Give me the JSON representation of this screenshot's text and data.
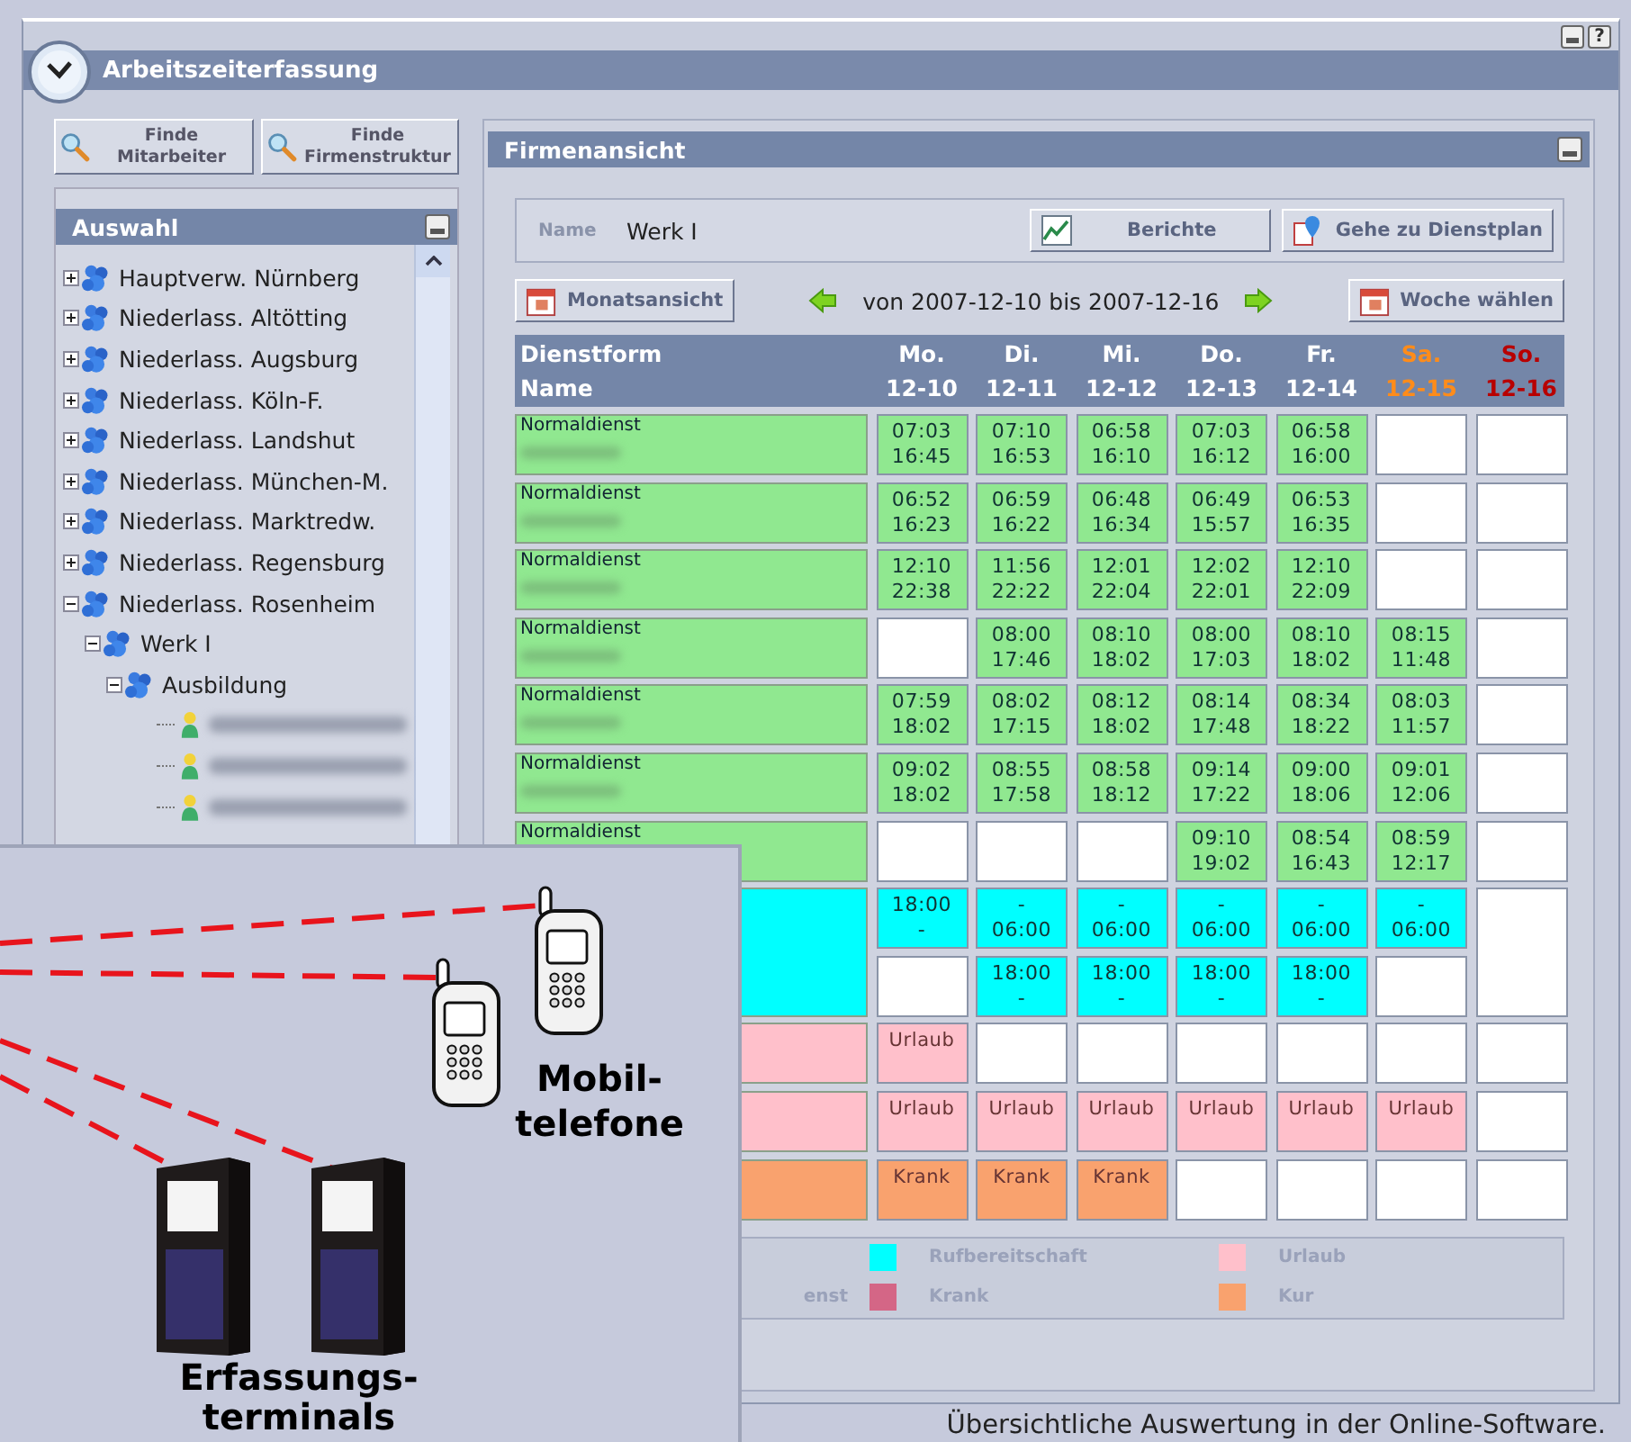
{
  "window": {
    "title": "Arbeitszeiterfassung",
    "help_glyph": "?"
  },
  "search_buttons": [
    {
      "lines": [
        "Finde",
        "Mitarbeiter"
      ]
    },
    {
      "lines": [
        "Finde",
        "Firmenstruktur"
      ]
    }
  ],
  "selection_panel": {
    "title": "Auswahl",
    "tree": [
      {
        "kind": "group",
        "label": "Hauptverw. Nürnberg",
        "expanded": false
      },
      {
        "kind": "group",
        "label": "Niederlass. Altötting",
        "expanded": false
      },
      {
        "kind": "group",
        "label": "Niederlass. Augsburg",
        "expanded": false
      },
      {
        "kind": "group",
        "label": "Niederlass. Köln-F.",
        "expanded": false
      },
      {
        "kind": "group",
        "label": "Niederlass. Landshut",
        "expanded": false
      },
      {
        "kind": "group",
        "label": "Niederlass. München-M.",
        "expanded": false
      },
      {
        "kind": "group",
        "label": "Niederlass. Marktredw.",
        "expanded": false
      },
      {
        "kind": "group",
        "label": "Niederlass. Regensburg",
        "expanded": false
      },
      {
        "kind": "group",
        "label": "Niederlass. Rosenheim",
        "expanded": true,
        "children": [
          {
            "kind": "group",
            "label": "Werk I",
            "expanded": true,
            "children": [
              {
                "kind": "group",
                "label": "Ausbildung",
                "expanded": true,
                "children": [
                  {
                    "kind": "person"
                  },
                  {
                    "kind": "person"
                  },
                  {
                    "kind": "person"
                  }
                ]
              }
            ]
          }
        ]
      }
    ]
  },
  "company_view": {
    "title": "Firmenansicht",
    "name_label": "Name",
    "name_value": "Werk I",
    "buttons": [
      "Berichte",
      "Gehe zu Dienstplan"
    ],
    "month_button": "Monatsansicht",
    "range": "von 2007-12-10 bis 2007-12-16",
    "week_button": "Woche wählen",
    "table": {
      "header": [
        "Dienstform",
        "Name"
      ],
      "days": [
        {
          "day": "Mo.",
          "date": "12-10",
          "kind": "weekday"
        },
        {
          "day": "Di.",
          "date": "12-11",
          "kind": "weekday"
        },
        {
          "day": "Mi.",
          "date": "12-12",
          "kind": "weekday"
        },
        {
          "day": "Do.",
          "date": "12-13",
          "kind": "weekday"
        },
        {
          "day": "Fr.",
          "date": "12-14",
          "kind": "weekday"
        },
        {
          "day": "Sa.",
          "date": "12-15",
          "kind": "saturday"
        },
        {
          "day": "So.",
          "date": "12-16",
          "kind": "sunday"
        }
      ],
      "rows": [
        {
          "name_cell": {
            "kind": "work",
            "label": "Normaldienst",
            "name_hidden": true
          },
          "cells": [
            {
              "kind": "work",
              "lines": [
                "07:03",
                "16:45"
              ]
            },
            {
              "kind": "work",
              "lines": [
                "07:10",
                "16:53"
              ]
            },
            {
              "kind": "work",
              "lines": [
                "06:58",
                "16:10"
              ]
            },
            {
              "kind": "work",
              "lines": [
                "07:03",
                "16:12"
              ]
            },
            {
              "kind": "work",
              "lines": [
                "06:58",
                "16:00"
              ]
            },
            {
              "kind": "empty"
            },
            {
              "kind": "empty"
            }
          ]
        },
        {
          "name_cell": {
            "kind": "work",
            "label": "Normaldienst",
            "name_hidden": true
          },
          "cells": [
            {
              "kind": "work",
              "lines": [
                "06:52",
                "16:23"
              ]
            },
            {
              "kind": "work",
              "lines": [
                "06:59",
                "16:22"
              ]
            },
            {
              "kind": "work",
              "lines": [
                "06:48",
                "16:34"
              ]
            },
            {
              "kind": "work",
              "lines": [
                "06:49",
                "15:57"
              ]
            },
            {
              "kind": "work",
              "lines": [
                "06:53",
                "16:35"
              ]
            },
            {
              "kind": "empty"
            },
            {
              "kind": "empty"
            }
          ]
        },
        {
          "name_cell": {
            "kind": "work",
            "label": "Normaldienst",
            "name_hidden": true
          },
          "cells": [
            {
              "kind": "work",
              "lines": [
                "12:10",
                "22:38"
              ]
            },
            {
              "kind": "work",
              "lines": [
                "11:56",
                "22:22"
              ]
            },
            {
              "kind": "work",
              "lines": [
                "12:01",
                "22:04"
              ]
            },
            {
              "kind": "work",
              "lines": [
                "12:02",
                "22:01"
              ]
            },
            {
              "kind": "work",
              "lines": [
                "12:10",
                "22:09"
              ]
            },
            {
              "kind": "empty"
            },
            {
              "kind": "empty"
            }
          ]
        },
        {
          "name_cell": {
            "kind": "work",
            "label": "Normaldienst",
            "name_hidden": true
          },
          "cells": [
            {
              "kind": "empty"
            },
            {
              "kind": "work",
              "lines": [
                "08:00",
                "17:46"
              ]
            },
            {
              "kind": "work",
              "lines": [
                "08:10",
                "18:02"
              ]
            },
            {
              "kind": "work",
              "lines": [
                "08:00",
                "17:03"
              ]
            },
            {
              "kind": "work",
              "lines": [
                "08:10",
                "18:02"
              ]
            },
            {
              "kind": "work",
              "lines": [
                "08:15",
                "11:48"
              ]
            },
            {
              "kind": "empty"
            }
          ]
        },
        {
          "name_cell": {
            "kind": "work",
            "label": "Normaldienst",
            "name_hidden": true
          },
          "cells": [
            {
              "kind": "work",
              "lines": [
                "07:59",
                "18:02"
              ]
            },
            {
              "kind": "work",
              "lines": [
                "08:02",
                "17:15"
              ]
            },
            {
              "kind": "work",
              "lines": [
                "08:12",
                "18:02"
              ]
            },
            {
              "kind": "work",
              "lines": [
                "08:14",
                "17:48"
              ]
            },
            {
              "kind": "work",
              "lines": [
                "08:34",
                "18:22"
              ]
            },
            {
              "kind": "work",
              "lines": [
                "08:03",
                "11:57"
              ]
            },
            {
              "kind": "empty"
            }
          ]
        },
        {
          "name_cell": {
            "kind": "work",
            "label": "Normaldienst",
            "name_hidden": true
          },
          "cells": [
            {
              "kind": "work",
              "lines": [
                "09:02",
                "18:02"
              ]
            },
            {
              "kind": "work",
              "lines": [
                "08:55",
                "17:58"
              ]
            },
            {
              "kind": "work",
              "lines": [
                "08:58",
                "18:12"
              ]
            },
            {
              "kind": "work",
              "lines": [
                "09:14",
                "17:22"
              ]
            },
            {
              "kind": "work",
              "lines": [
                "09:00",
                "18:06"
              ]
            },
            {
              "kind": "work",
              "lines": [
                "09:01",
                "12:06"
              ]
            },
            {
              "kind": "empty"
            }
          ]
        },
        {
          "name_cell": {
            "kind": "work",
            "label": "Normaldienst",
            "name_hidden": false
          },
          "cells": [
            {
              "kind": "empty"
            },
            {
              "kind": "empty"
            },
            {
              "kind": "empty"
            },
            {
              "kind": "work",
              "lines": [
                "09:10",
                "19:02"
              ]
            },
            {
              "kind": "work",
              "lines": [
                "08:54",
                "16:43"
              ]
            },
            {
              "kind": "work",
              "lines": [
                "08:59",
                "12:17"
              ]
            },
            {
              "kind": "empty"
            }
          ]
        },
        {
          "name_cell": {
            "kind": "standby",
            "tall": true
          },
          "cells": [
            {
              "kind": "standby",
              "lines": [
                "18:00",
                "-"
              ]
            },
            {
              "kind": "standby",
              "lines": [
                "-",
                "06:00"
              ]
            },
            {
              "kind": "standby",
              "lines": [
                "-",
                "06:00"
              ]
            },
            {
              "kind": "standby",
              "lines": [
                "-",
                "06:00"
              ]
            },
            {
              "kind": "standby",
              "lines": [
                "-",
                "06:00"
              ]
            },
            {
              "kind": "standby",
              "lines": [
                "-",
                "06:00"
              ]
            },
            {
              "kind": "empty",
              "tall": true
            }
          ]
        },
        {
          "cells": [
            {
              "kind": "empty"
            },
            {
              "kind": "standby",
              "lines": [
                "18:00",
                "-"
              ]
            },
            {
              "kind": "standby",
              "lines": [
                "18:00",
                "-"
              ]
            },
            {
              "kind": "standby",
              "lines": [
                "18:00",
                "-"
              ]
            },
            {
              "kind": "standby",
              "lines": [
                "18:00",
                "-"
              ]
            },
            {
              "kind": "empty"
            }
          ]
        },
        {
          "name_cell": {
            "kind": "vacation"
          },
          "cells": [
            {
              "kind": "vacation",
              "lines": [
                "Urlaub"
              ]
            },
            {
              "kind": "empty"
            },
            {
              "kind": "empty"
            },
            {
              "kind": "empty"
            },
            {
              "kind": "empty"
            },
            {
              "kind": "empty"
            },
            {
              "kind": "empty"
            }
          ]
        },
        {
          "name_cell": {
            "kind": "vacation"
          },
          "cells": [
            {
              "kind": "vacation",
              "lines": [
                "Urlaub"
              ]
            },
            {
              "kind": "vacation",
              "lines": [
                "Urlaub"
              ]
            },
            {
              "kind": "vacation",
              "lines": [
                "Urlaub"
              ]
            },
            {
              "kind": "vacation",
              "lines": [
                "Urlaub"
              ]
            },
            {
              "kind": "vacation",
              "lines": [
                "Urlaub"
              ]
            },
            {
              "kind": "vacation",
              "lines": [
                "Urlaub"
              ]
            },
            {
              "kind": "empty"
            }
          ]
        },
        {
          "name_cell": {
            "kind": "sick"
          },
          "cells": [
            {
              "kind": "sick",
              "lines": [
                "Krank"
              ]
            },
            {
              "kind": "sick",
              "lines": [
                "Krank"
              ]
            },
            {
              "kind": "sick",
              "lines": [
                "Krank"
              ]
            },
            {
              "kind": "empty"
            },
            {
              "kind": "empty"
            },
            {
              "kind": "empty"
            },
            {
              "kind": "empty"
            }
          ]
        }
      ]
    },
    "legend": {
      "fragment": "enst",
      "items": [
        {
          "color": "#00ffff",
          "label": "Rufbereitschaft"
        },
        {
          "color": "#ffc0cb",
          "label": "Urlaub"
        },
        {
          "color": "#d46686",
          "label": "Krank"
        },
        {
          "color": "#f9a26e",
          "label": "Kur"
        }
      ]
    }
  },
  "overlay": {
    "phones_label": [
      "Mobil-",
      "telefone"
    ],
    "terminals_label": [
      "Erfassungs-",
      "terminals"
    ]
  },
  "caption": "Übersichtliche Auswertung in der Online-Software."
}
